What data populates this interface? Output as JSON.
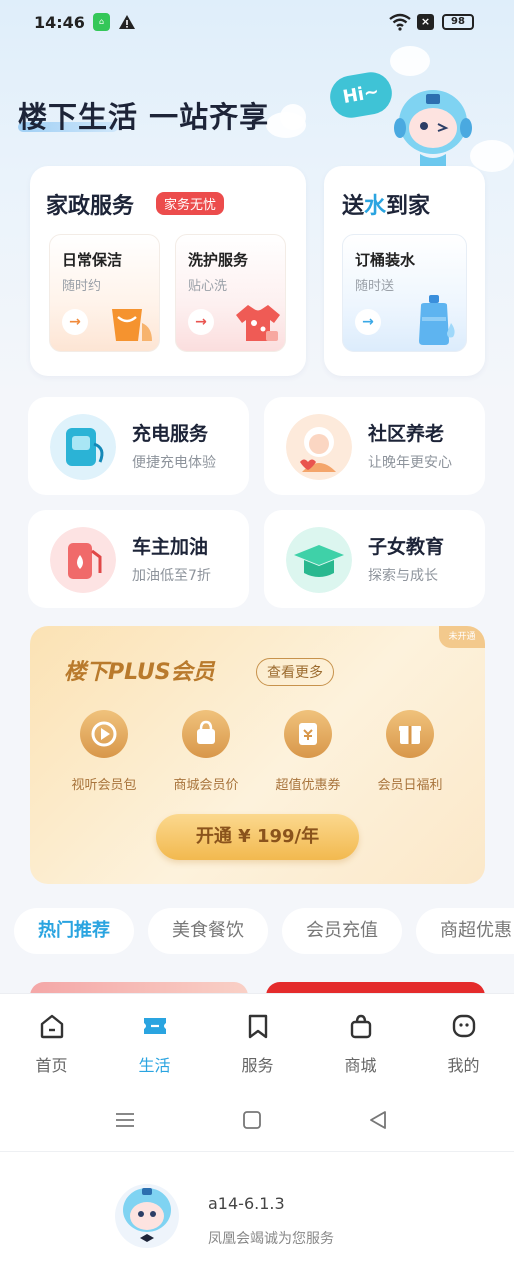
{
  "status_bar": {
    "time": "14:46",
    "battery": "98"
  },
  "hero": {
    "title": "楼下生活 一站齐享",
    "bubble": "Hi~"
  },
  "housekeeping": {
    "title": "家政服务",
    "tag": "家务无忧",
    "items": [
      {
        "name": "日常保洁",
        "desc": "随时约"
      },
      {
        "name": "洗护服务",
        "desc": "贴心洗"
      }
    ]
  },
  "water": {
    "title_pre": "送",
    "title_mid": "水",
    "title_post": "到家",
    "item": {
      "name": "订桶装水",
      "desc": "随时送"
    }
  },
  "services": [
    {
      "name": "充电服务",
      "desc": "便捷充电体验"
    },
    {
      "name": "社区养老",
      "desc": "让晚年更安心"
    },
    {
      "name": "车主加油",
      "desc": "加油低至7折"
    },
    {
      "name": "子女教育",
      "desc": "探索与成长"
    }
  ],
  "plus": {
    "corner": "未开通",
    "title": "楼下PLUS会员",
    "more": "查看更多",
    "benefits": [
      "视听会员包",
      "商城会员价",
      "超值优惠券",
      "会员日福利"
    ],
    "cta": "开通 ¥ 199/年"
  },
  "chips": [
    "热门推荐",
    "美食餐饮",
    "会员充值",
    "商超优惠"
  ],
  "tabs": [
    "首页",
    "生活",
    "服务",
    "商城",
    "我的"
  ],
  "footer": {
    "version": "a14-6.1.3",
    "note": "凤凰会竭诚为您服务"
  },
  "colors": {
    "accent": "#2aa4e0",
    "tag_red": "#ec4c4c",
    "gold": "#b97a2c"
  }
}
